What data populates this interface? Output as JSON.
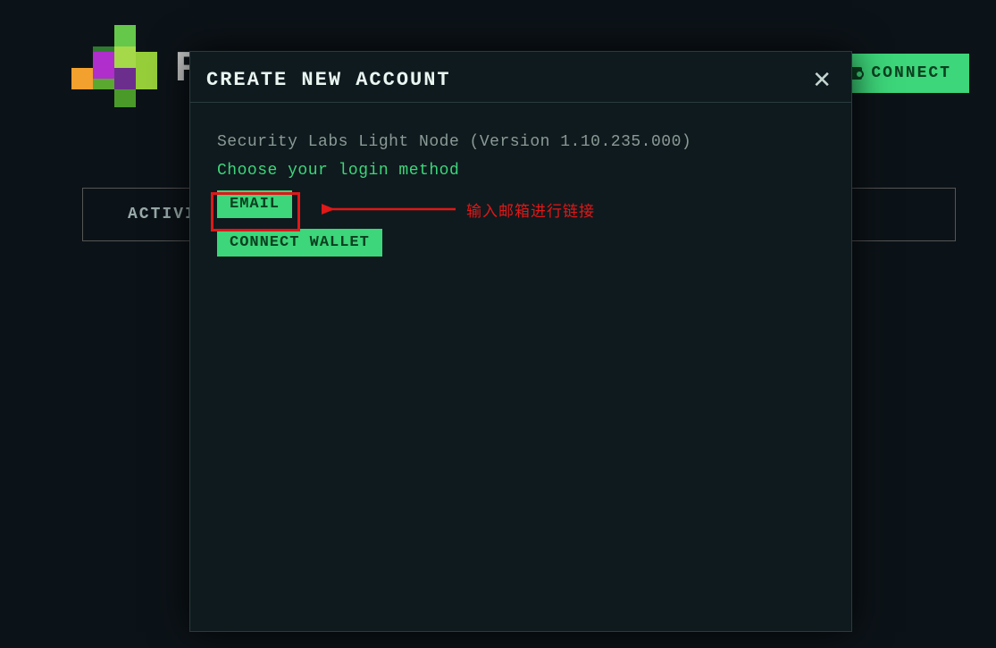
{
  "header": {
    "brand_partial": "F",
    "connect_label": "CONNECT"
  },
  "tabs": {
    "activity_label": "ACTIVI"
  },
  "modal": {
    "title": "CREATE NEW ACCOUNT",
    "version_line": "Security Labs Light Node (Version 1.10.235.000)",
    "prompt": "Choose your login method",
    "email_label": "EMAIL",
    "wallet_label": "CONNECT WALLET",
    "close_glyph": "✕"
  },
  "annotation": {
    "text": "输入邮箱进行链接"
  }
}
